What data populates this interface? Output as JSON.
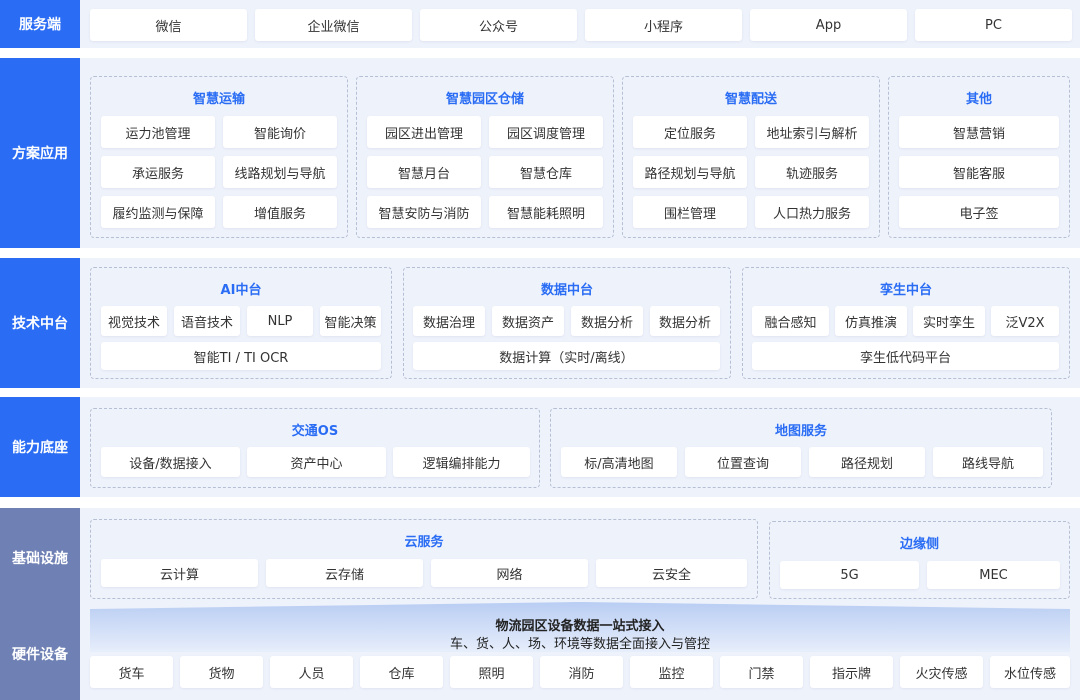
{
  "layers": {
    "service": {
      "label": "服务端",
      "items": [
        "微信",
        "企业微信",
        "公众号",
        "小程序",
        "App",
        "PC"
      ]
    },
    "solution": {
      "label": "方案应用",
      "groups": [
        {
          "title": "智慧运输",
          "items": [
            "运力池管理",
            "智能询价",
            "承运服务",
            "线路规划与导航",
            "履约监测与保障",
            "增值服务"
          ]
        },
        {
          "title": "智慧园区仓储",
          "items": [
            "园区进出管理",
            "园区调度管理",
            "智慧月台",
            "智慧仓库",
            "智慧安防与消防",
            "智慧能耗照明"
          ]
        },
        {
          "title": "智慧配送",
          "items": [
            "定位服务",
            "地址索引与解析",
            "路径规划与导航",
            "轨迹服务",
            "围栏管理",
            "人口热力服务"
          ]
        },
        {
          "title": "其他",
          "items": [
            "智慧营销",
            "智能客服",
            "电子签"
          ]
        }
      ]
    },
    "tech": {
      "label": "技术中台",
      "groups": [
        {
          "title": "AI中台",
          "items": [
            "视觉技术",
            "语音技术",
            "NLP",
            "智能决策"
          ],
          "wide": "智能TI / TI OCR"
        },
        {
          "title": "数据中台",
          "items": [
            "数据治理",
            "数据资产",
            "数据分析",
            "数据分析"
          ],
          "wide": "数据计算（实时/离线）"
        },
        {
          "title": "孪生中台",
          "items": [
            "融合感知",
            "仿真推演",
            "实时孪生",
            "泛V2X"
          ],
          "wide": "孪生低代码平台"
        }
      ]
    },
    "capability": {
      "label": "能力底座",
      "groups": [
        {
          "title": "交通OS",
          "items": [
            "设备/数据接入",
            "资产中心",
            "逻辑编排能力"
          ]
        },
        {
          "title": "地图服务",
          "items": [
            "标/高清地图",
            "位置查询",
            "路径规划",
            "路线导航"
          ]
        }
      ]
    },
    "infra": {
      "label": "基础设施",
      "groups": [
        {
          "title": "云服务",
          "items": [
            "云计算",
            "云存储",
            "网络",
            "云安全"
          ]
        },
        {
          "title": "边缘侧",
          "items": [
            "5G",
            "MEC"
          ]
        }
      ]
    },
    "hardware": {
      "label": "硬件设备",
      "banner_title": "物流园区设备数据一站式接入",
      "banner_subtitle": "车、货、人、场、环境等数据全面接入与管控",
      "items": [
        "货车",
        "货物",
        "人员",
        "仓库",
        "照明",
        "消防",
        "监控",
        "门禁",
        "指示牌",
        "火灾传感",
        "水位传感"
      ]
    }
  },
  "colors": {
    "label_blue": "#2a6df4",
    "label_gray_blue": "#6f80b4",
    "accent": "#2a6df4"
  }
}
